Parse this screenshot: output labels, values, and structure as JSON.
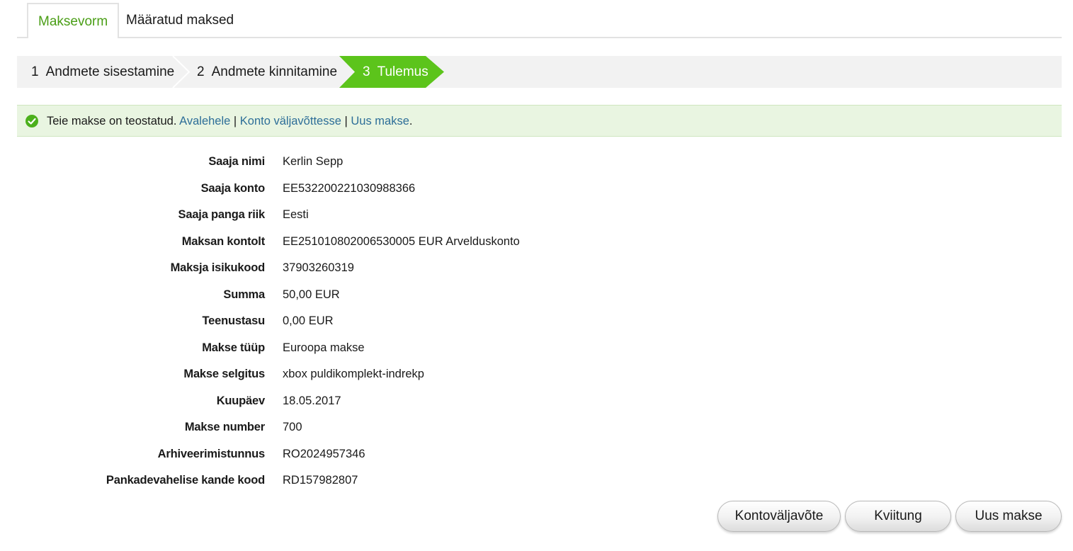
{
  "tabs": [
    {
      "label": "Maksevorm",
      "active": true
    },
    {
      "label": "Määratud maksed",
      "active": false
    }
  ],
  "steps": [
    {
      "num": "1",
      "label": "Andmete sisestamine"
    },
    {
      "num": "2",
      "label": "Andmete kinnitamine"
    },
    {
      "num": "3",
      "label": "Tulemus",
      "active": true
    }
  ],
  "alert": {
    "icon": "check-circle-icon",
    "message": "Teie makse on teostatud.",
    "links": [
      "Avalehele",
      "Konto väljavõttesse",
      "Uus makse"
    ],
    "separator": "|",
    "end": "."
  },
  "details": [
    {
      "label": "Saaja nimi",
      "value": "Kerlin Sepp"
    },
    {
      "label": "Saaja konto",
      "value": "EE532200221030988366"
    },
    {
      "label": "Saaja panga riik",
      "value": "Eesti"
    },
    {
      "label": "Maksan kontolt",
      "value": "EE251010802006530005 EUR Arvelduskonto"
    },
    {
      "label": "Maksja isikukood",
      "value": "37903260319"
    },
    {
      "label": "Summa",
      "value": "50,00 EUR"
    },
    {
      "label": "Teenustasu",
      "value": "0,00 EUR"
    },
    {
      "label": "Makse tüüp",
      "value": "Euroopa makse"
    },
    {
      "label": "Makse selgitus",
      "value": "xbox puldikomplekt-indrekp"
    },
    {
      "label": "Kuupäev",
      "value": "18.05.2017"
    },
    {
      "label": "Makse number",
      "value": "700"
    },
    {
      "label": "Arhiveerimistunnus",
      "value": "RO2024957346"
    },
    {
      "label": "Pankadevahelise kande kood",
      "value": "RD157982807"
    }
  ],
  "buttons": {
    "statement": "Kontoväljavõte",
    "receipt": "Kviitung",
    "new_payment": "Uus makse"
  },
  "colors": {
    "accent_green": "#5cc41b",
    "tab_active_text": "#4a9e16",
    "link": "#2d6e98",
    "alert_bg": "#e9f5e1"
  }
}
